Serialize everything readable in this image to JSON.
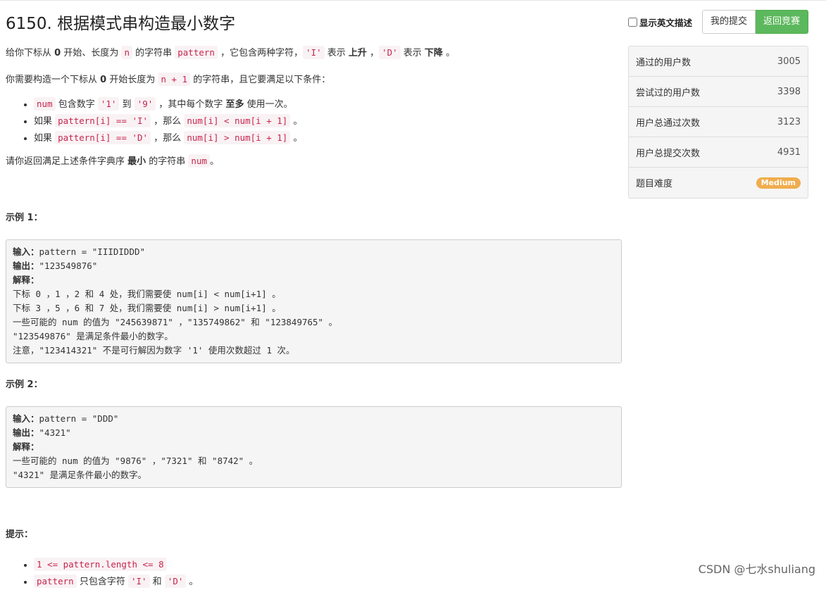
{
  "header": {
    "title": "6150. 根据模式串构造最小数字",
    "english_toggle": "显示英文描述",
    "my_submissions": "我的提交",
    "back_to_contest": "返回竞赛"
  },
  "description": {
    "p1": {
      "t1": "给你下标从 ",
      "b1": "0",
      "t2": " 开始、长度为 ",
      "c1": "n",
      "t3": " 的字符串 ",
      "c2": "pattern",
      "t4": " ，它包含两种字符，",
      "c3": "'I'",
      "t5": " 表示 ",
      "b2": "上升",
      "t6": " ，",
      "c4": "'D'",
      "t7": " 表示 ",
      "b3": "下降",
      "t8": " 。"
    },
    "p2": {
      "t1": "你需要构造一个下标从 ",
      "b1": "0",
      "t2": " 开始长度为 ",
      "c1": "n + 1",
      "t3": " 的字符串，且它要满足以下条件："
    },
    "conditions": [
      {
        "c1": "num",
        "t1": " 包含数字 ",
        "c2": "'1'",
        "t2": " 到 ",
        "c3": "'9'",
        "t3": " ，其中每个数字 ",
        "b1": "至多",
        "t4": " 使用一次。"
      },
      {
        "t0": "如果 ",
        "c1": "pattern[i] == 'I'",
        "t1": " ，那么 ",
        "c2": "num[i] < num[i + 1]",
        "t2": " 。"
      },
      {
        "t0": "如果 ",
        "c1": "pattern[i] == 'D'",
        "t1": " ，那么 ",
        "c2": "num[i] > num[i + 1]",
        "t2": " 。"
      }
    ],
    "p3": {
      "t1": "请你返回满足上述条件字典序 ",
      "b1": "最小",
      "t2": " 的字符串 ",
      "c1": "num",
      "t3": "。"
    }
  },
  "examples": [
    {
      "label": "示例 1：",
      "input_label": "输入：",
      "input": "pattern = \"IIIDIDDD\"",
      "output_label": "输出：",
      "output": "\"123549876\"",
      "explain_label": "解释：",
      "lines": [
        "下标 0 ，1 ，2 和 4 处，我们需要使 num[i] < num[i+1] 。",
        "下标 3 ，5 ，6 和 7 处，我们需要使 num[i] > num[i+1] 。",
        "一些可能的 num 的值为 \"245639871\" ，\"135749862\" 和 \"123849765\" 。",
        "\"123549876\" 是满足条件最小的数字。",
        "注意，\"123414321\" 不是可行解因为数字 '1' 使用次数超过 1 次。"
      ]
    },
    {
      "label": "示例 2：",
      "input_label": "输入：",
      "input": "pattern = \"DDD\"",
      "output_label": "输出：",
      "output": "\"4321\"",
      "explain_label": "解释：",
      "lines": [
        "一些可能的 num 的值为 \"9876\" ，\"7321\" 和 \"8742\" 。",
        "\"4321\" 是满足条件最小的数字。"
      ]
    }
  ],
  "hints": {
    "label": "提示：",
    "items": [
      {
        "c1": "1 <= pattern.length <= 8"
      },
      {
        "c1": "pattern",
        "t1": " 只包含字符 ",
        "c2": "'I'",
        "t2": " 和 ",
        "c3": "'D'",
        "t3": " 。"
      }
    ]
  },
  "stats": [
    {
      "label": "通过的用户数",
      "value": "3005"
    },
    {
      "label": "尝试过的用户数",
      "value": "3398"
    },
    {
      "label": "用户总通过次数",
      "value": "3123"
    },
    {
      "label": "用户总提交次数",
      "value": "4931"
    }
  ],
  "difficulty": {
    "label": "题目难度",
    "value": "Medium"
  },
  "colors": {
    "success": "#5cb85c",
    "medium_badge": "#f0ad4e",
    "code_text": "#c7254e",
    "code_bg": "#f9f2f4"
  },
  "watermark": "CSDN @七水shuliang"
}
